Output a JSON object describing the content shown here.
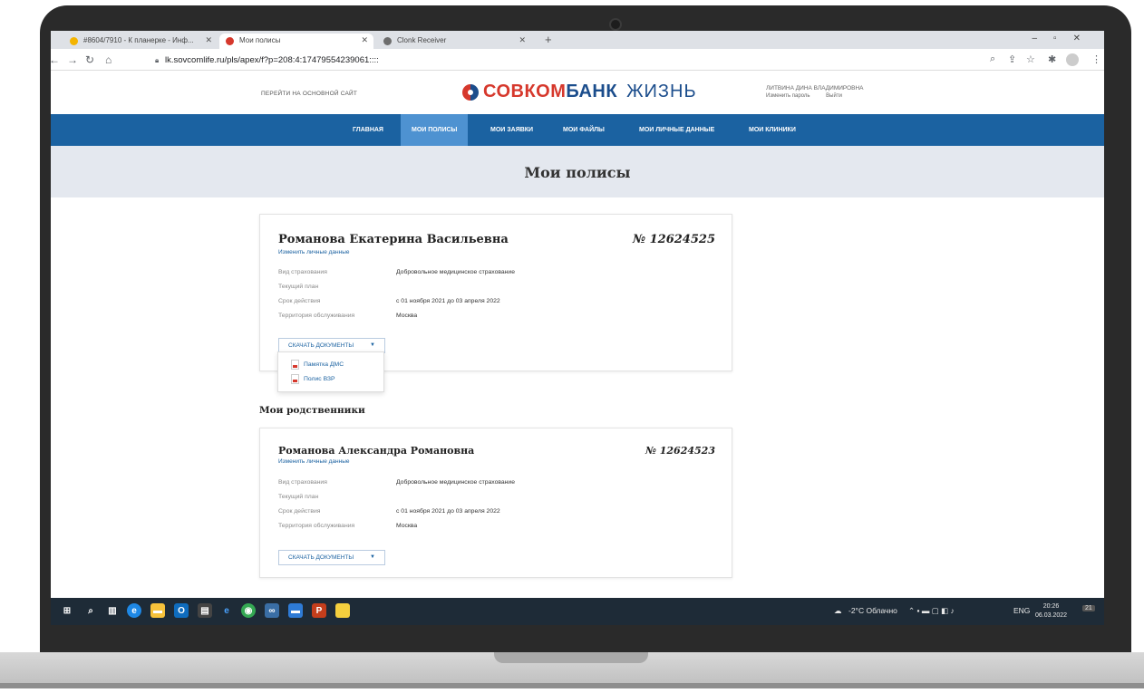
{
  "browser": {
    "tabs": [
      {
        "label": "#8604/7910 - К планерке - Инф...",
        "favicon_color": "#f4b400",
        "active": false
      },
      {
        "label": "Мои полисы",
        "favicon_color": "#d6382c",
        "active": true
      },
      {
        "label": "Clonk Receiver",
        "favicon_color": "#6d6d6d",
        "active": false
      }
    ],
    "url": "lk.sovcomlife.ru/pls/apex/f?p=208:4:17479554239061::::",
    "nav_icons": [
      "back-icon",
      "forward-icon",
      "reload-icon",
      "home-icon"
    ],
    "right_icons": [
      "zoom-icon",
      "share-icon",
      "star-icon",
      "extensions-icon",
      "profile-icon",
      "menu-icon"
    ]
  },
  "header": {
    "goto_main": "ПЕРЕЙТИ НА ОСНОВНОЙ САЙТ",
    "logo": {
      "part1": "СОВКОМ",
      "part2": "БАНК",
      "part3": "ЖИЗНЬ"
    },
    "user_name": "ЛИТВИНА ДИНА ВЛАДИМИРОВНА",
    "change_password": "Изменить пароль",
    "logout": "Выйти"
  },
  "nav": {
    "items": [
      {
        "label": "ГЛАВНАЯ",
        "active": false
      },
      {
        "label": "МОИ ПОЛИСЫ",
        "active": true
      },
      {
        "label": "МОИ ЗАЯВКИ",
        "active": false
      },
      {
        "label": "МОИ ФАЙЛЫ",
        "active": false
      },
      {
        "label": "МОИ ЛИЧНЫЕ ДАННЫЕ",
        "active": false
      },
      {
        "label": "МОИ КЛИНИКИ",
        "active": false
      }
    ]
  },
  "page_title": "Мои полисы",
  "policies": {
    "main": {
      "name": "Романова Екатерина Васильевна",
      "edit_link": "Изменить личные данные",
      "number": "№ 12624525",
      "rows": [
        {
          "label": "Вид страхования",
          "value": "Добровольное медицинское страхование"
        },
        {
          "label": "Текущий план",
          "value": ""
        },
        {
          "label": "Срок действия",
          "value": "с 01 ноября 2021 до 03 апреля 2022"
        },
        {
          "label": "Территория обслуживания",
          "value": "Москва"
        }
      ],
      "download_label": "СКАЧАТЬ ДОКУМЕНТЫ",
      "dropdown": [
        {
          "label": "Памятка ДМС"
        },
        {
          "label": "Полис ВЗР"
        }
      ]
    },
    "relatives_title": "Мои родственники",
    "relative": {
      "name": "Романова Александра Романовна",
      "edit_link": "Изменить личные данные",
      "number": "№ 12624523",
      "rows": [
        {
          "label": "Вид страхования",
          "value": "Добровольное медицинское страхование"
        },
        {
          "label": "Текущий план",
          "value": ""
        },
        {
          "label": "Срок действия",
          "value": "с 01 ноября 2021 до 03 апреля 2022"
        },
        {
          "label": "Территория обслуживания",
          "value": "Москва"
        }
      ],
      "download_label": "СКАЧАТЬ ДОКУМЕНТЫ"
    }
  },
  "taskbar": {
    "weather": "-2°C Облачно",
    "lang": "ENG",
    "time": "20:26",
    "date": "06.03.2022",
    "notifications": "21"
  }
}
